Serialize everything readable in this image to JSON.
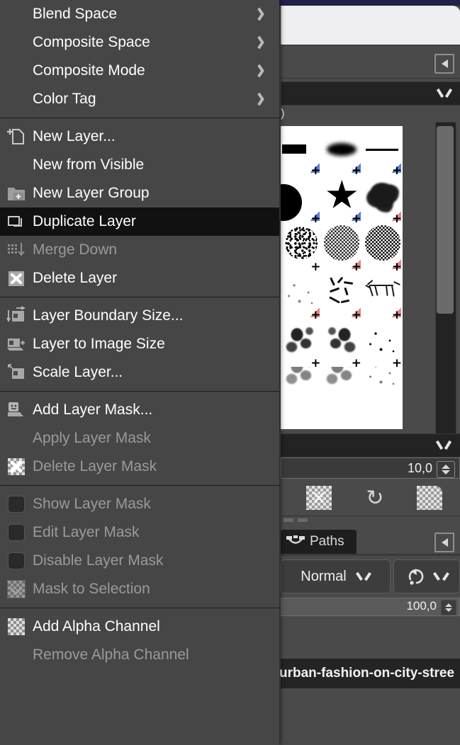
{
  "app": "GIMP",
  "menu": {
    "name": "Layer menu",
    "sections": [
      {
        "items": [
          {
            "label": "Blend Space",
            "icon": "none",
            "submenu": true,
            "state": "enabled"
          },
          {
            "label": "Composite Space",
            "icon": "none",
            "submenu": true,
            "state": "enabled"
          },
          {
            "label": "Composite Mode",
            "icon": "none",
            "submenu": true,
            "state": "enabled"
          },
          {
            "label": "Color Tag",
            "icon": "none",
            "submenu": true,
            "state": "enabled"
          }
        ]
      },
      {
        "items": [
          {
            "label": "New Layer...",
            "icon": "new-layer-icon",
            "submenu": false,
            "state": "enabled"
          },
          {
            "label": "New from Visible",
            "icon": "none",
            "submenu": false,
            "state": "enabled"
          },
          {
            "label": "New Layer Group",
            "icon": "new-layer-group-icon",
            "submenu": false,
            "state": "enabled"
          },
          {
            "label": "Duplicate Layer",
            "icon": "duplicate-layer-icon",
            "submenu": false,
            "state": "highlighted"
          },
          {
            "label": "Merge Down",
            "icon": "merge-down-icon",
            "submenu": false,
            "state": "disabled"
          },
          {
            "label": "Delete Layer",
            "icon": "delete-layer-icon",
            "submenu": false,
            "state": "enabled"
          }
        ]
      },
      {
        "items": [
          {
            "label": "Layer Boundary Size...",
            "icon": "layer-boundary-size-icon",
            "submenu": false,
            "state": "enabled"
          },
          {
            "label": "Layer to Image Size",
            "icon": "layer-to-image-size-icon",
            "submenu": false,
            "state": "enabled"
          },
          {
            "label": "Scale Layer...",
            "icon": "scale-layer-icon",
            "submenu": false,
            "state": "enabled"
          }
        ]
      },
      {
        "items": [
          {
            "label": "Add Layer Mask...",
            "icon": "add-layer-mask-icon",
            "submenu": false,
            "state": "enabled"
          },
          {
            "label": "Apply Layer Mask",
            "icon": "none",
            "submenu": false,
            "state": "disabled"
          },
          {
            "label": "Delete Layer Mask",
            "icon": "delete-layer-mask-icon",
            "submenu": false,
            "state": "disabled"
          }
        ]
      },
      {
        "items": [
          {
            "label": "Show Layer Mask",
            "icon": "checkbox-icon",
            "submenu": false,
            "state": "disabled"
          },
          {
            "label": "Edit Layer Mask",
            "icon": "checkbox-icon",
            "submenu": false,
            "state": "disabled"
          },
          {
            "label": "Disable Layer Mask",
            "icon": "checkbox-icon",
            "submenu": false,
            "state": "disabled"
          },
          {
            "label": "Mask to Selection",
            "icon": "mask-to-selection-icon",
            "submenu": false,
            "state": "disabled"
          }
        ]
      },
      {
        "items": [
          {
            "label": "Add Alpha Channel",
            "icon": "alpha-channel-icon",
            "submenu": false,
            "state": "enabled"
          },
          {
            "label": "Remove Alpha Channel",
            "icon": "none",
            "submenu": false,
            "state": "disabled"
          }
        ]
      }
    ]
  },
  "dock": {
    "brushes_panel": {
      "name": "Brushes",
      "scroll_thumb_visible": true
    },
    "spacing_value": "10,0",
    "partial_text": ")",
    "icon_buttons": [
      {
        "name": "delete-brush-button",
        "glyph": "✕"
      },
      {
        "name": "refresh-brushes-button",
        "glyph": "↻"
      },
      {
        "name": "new-brush-button",
        "glyph": ""
      }
    ],
    "tab": {
      "label": "Paths",
      "icon": "path-icon"
    },
    "blend_mode": "Normal",
    "opacity_value": "100,0",
    "layer_name": "urban-fashion-on-city-stree"
  },
  "colors": {
    "menu_bg": "#464646",
    "menu_highlight": "#111111",
    "text": "#ffffff",
    "text_disabled": "#9a9a9a",
    "separator": "#1c1c1c",
    "dock_bg": "#4a4a4a",
    "entry_dark": "#232323",
    "titlebar": "#20204a"
  }
}
